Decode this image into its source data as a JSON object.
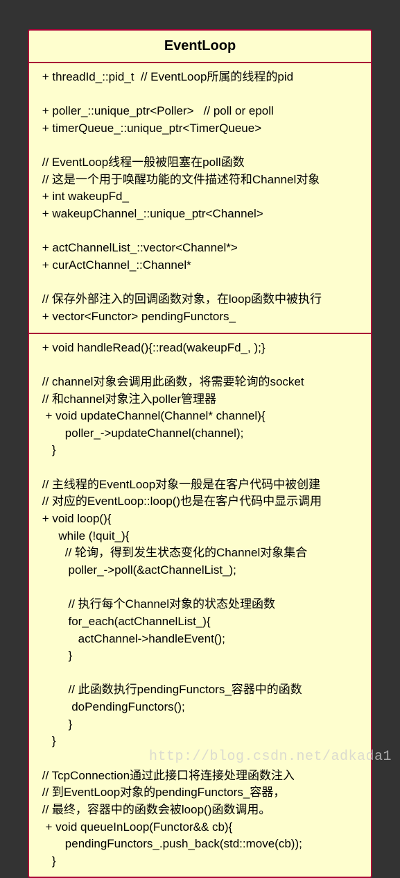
{
  "class": {
    "name": "EventLoop",
    "attributes": [
      " + threadId_::pid_t  // EventLoop所属的线程的pid",
      "",
      " + poller_::unique_ptr<Poller>   // poll or epoll",
      " + timerQueue_::unique_ptr<TimerQueue>",
      "",
      " // EventLoop线程一般被阻塞在poll函数",
      " // 这是一个用于唤醒功能的文件描述符和Channel对象",
      " + int wakeupFd_",
      " + wakeupChannel_::unique_ptr<Channel>",
      "",
      " + actChannelList_::vector<Channel*>",
      " + curActChannel_::Channel*",
      "",
      " // 保存外部注入的回调函数对象，在loop函数中被执行",
      " + vector<Functor> pendingFunctors_"
    ],
    "methods": [
      " + void handleRead(){::read(wakeupFd_, );}",
      "",
      " // channel对象会调用此函数，将需要轮询的socket",
      " // 和channel对象注入poller管理器",
      "  + void updateChannel(Channel* channel){",
      "        poller_->updateChannel(channel);",
      "    }",
      "",
      " // 主线程的EventLoop对象一般是在客户代码中被创建",
      " // 对应的EventLoop::loop()也是在客户代码中显示调用",
      " + void loop(){",
      "      while (!quit_){",
      "        // 轮询，得到发生状态变化的Channel对象集合",
      "         poller_->poll(&actChannelList_);",
      "",
      "         // 执行每个Channel对象的状态处理函数",
      "         for_each(actChannelList_){",
      "            actChannel->handleEvent();",
      "         }",
      "",
      "         // 此函数执行pendingFunctors_容器中的函数",
      "          doPendingFunctors();",
      "         }",
      "    }",
      "",
      " // TcpConnection通过此接口将连接处理函数注入",
      " // 到EventLoop对象的pendingFunctors_容器，",
      " // 最终，容器中的函数会被loop()函数调用。",
      "  + void queueInLoop(Functor&& cb){",
      "        pendingFunctors_.push_back(std::move(cb));",
      "    }"
    ]
  },
  "watermark": "http://blog.csdn.net/adkada1"
}
